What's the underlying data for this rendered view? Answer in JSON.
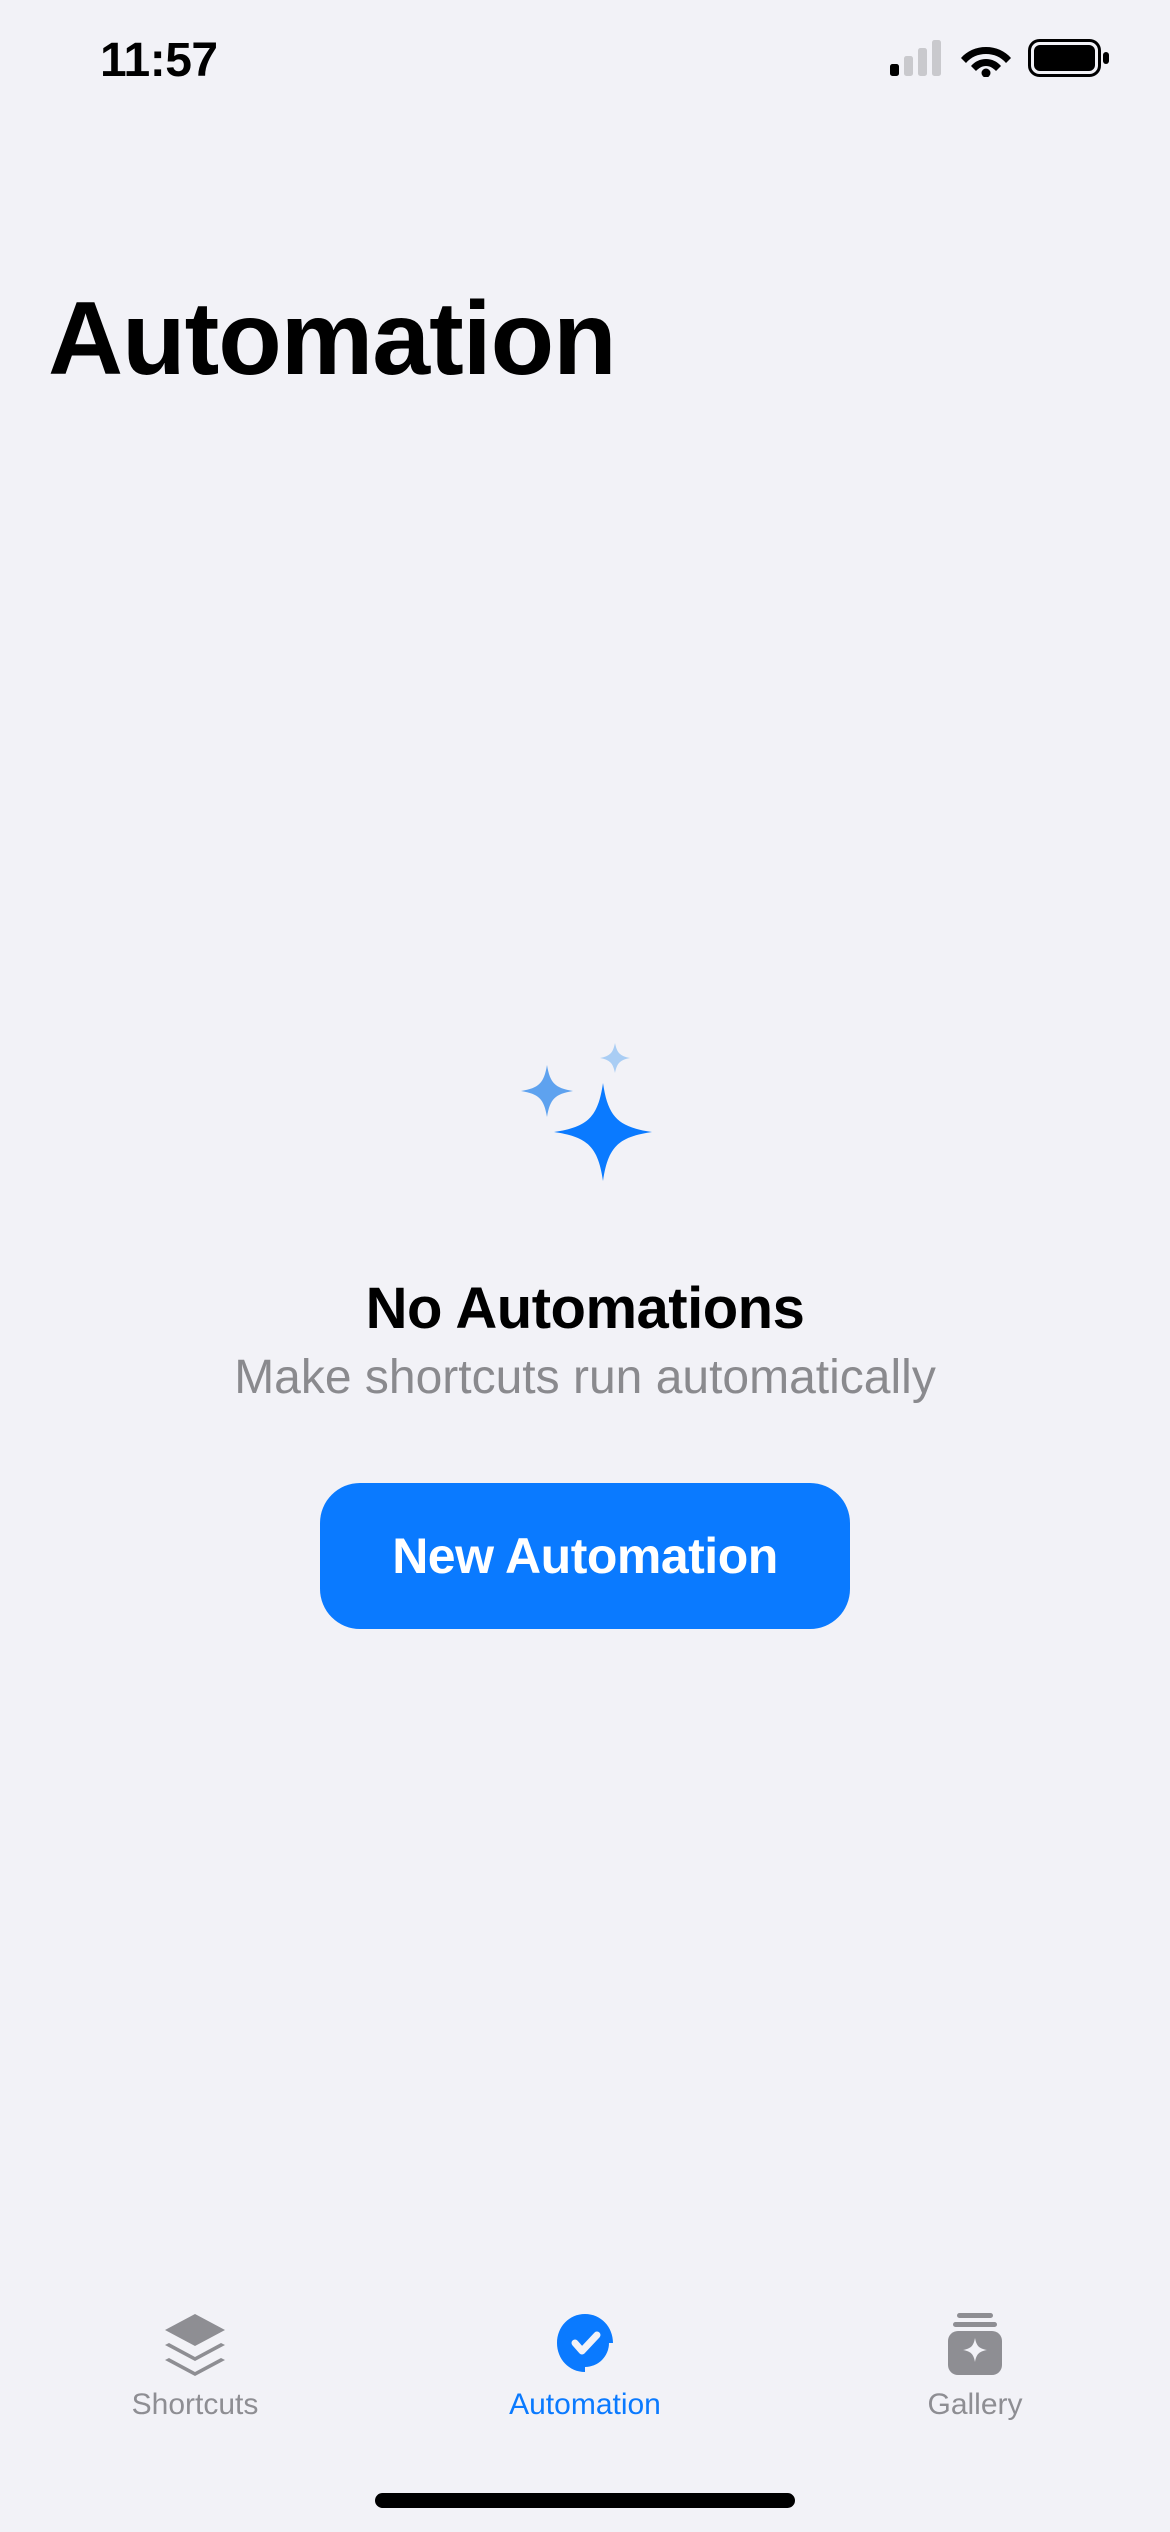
{
  "status_bar": {
    "time": "11:57"
  },
  "header": {
    "title": "Automation"
  },
  "empty_state": {
    "title": "No Automations",
    "subtitle": "Make shortcuts run automatically",
    "button_label": "New Automation"
  },
  "tab_bar": {
    "items": [
      {
        "label": "Shortcuts",
        "icon": "layers-icon",
        "active": false
      },
      {
        "label": "Automation",
        "icon": "automation-icon",
        "active": true
      },
      {
        "label": "Gallery",
        "icon": "gallery-icon",
        "active": false
      }
    ]
  },
  "colors": {
    "accent": "#0a7aff",
    "background": "#f2f2f7",
    "inactive": "#8e8e93",
    "subtitle": "#8a8a8e"
  }
}
